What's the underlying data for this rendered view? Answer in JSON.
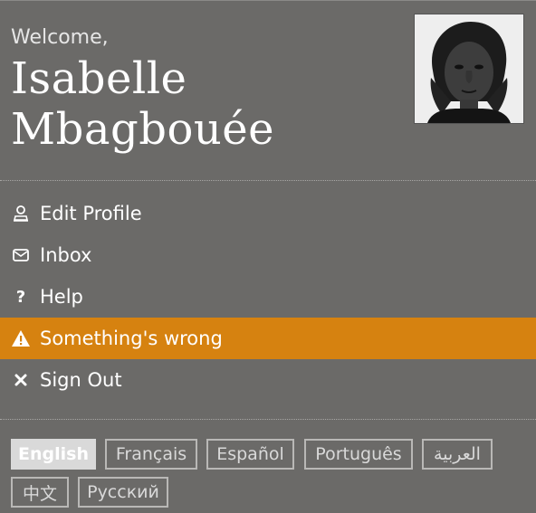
{
  "user": {
    "greeting": "Welcome,",
    "first_name": "Isabelle",
    "last_name": "Mbagbouée"
  },
  "menu": {
    "items": [
      {
        "label": "Edit Profile",
        "icon": "profile-icon"
      },
      {
        "label": "Inbox",
        "icon": "envelope-icon"
      },
      {
        "label": "Help",
        "icon": "question-icon"
      },
      {
        "label": "Something's wrong",
        "icon": "warning-icon"
      },
      {
        "label": "Sign Out",
        "icon": "close-icon"
      }
    ],
    "active_index": 3
  },
  "languages": {
    "selected": "English",
    "items": [
      "English",
      "Français",
      "Español",
      "Português",
      "العربية",
      "中文",
      "Русский"
    ]
  },
  "colors": {
    "background": "#6b6a68",
    "accent": "#d68210",
    "selected_language": "#d9d9d9"
  }
}
